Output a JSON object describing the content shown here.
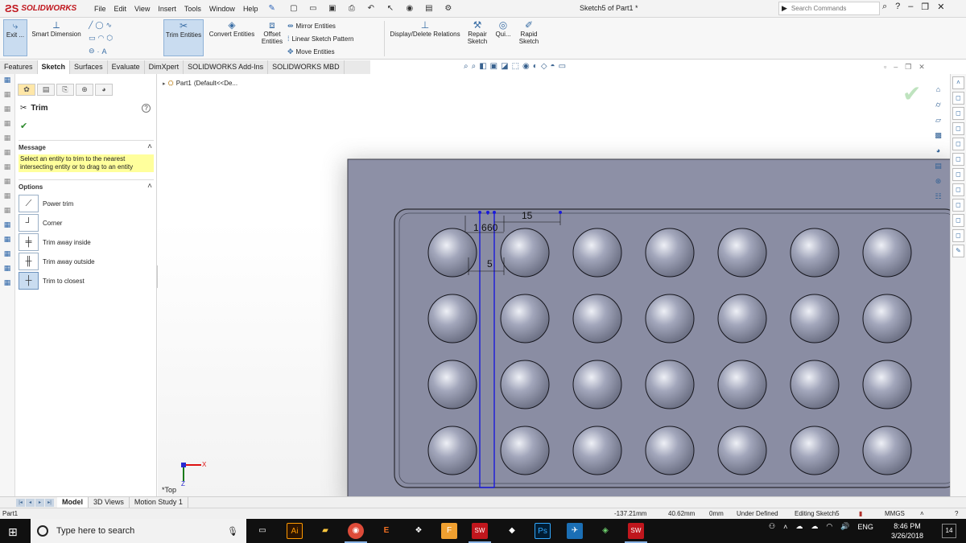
{
  "app": {
    "brand": "SOLIDWORKS",
    "menu": [
      "File",
      "Edit",
      "View",
      "Insert",
      "Tools",
      "Window",
      "Help"
    ],
    "doc_title": "Sketch5 of Part1 *",
    "search_placeholder": "Search Commands"
  },
  "ribbon": {
    "exit": "Exit ...",
    "smart_dimension": "Smart Dimension",
    "trim_entities": "Trim Entities",
    "convert_entities": "Convert Entities",
    "offset_entities_1": "Offset",
    "offset_entities_2": "Entities",
    "mirror": "Mirror Entities",
    "linear_pattern": "Linear Sketch Pattern",
    "move": "Move Entities",
    "display_delete": "Display/Delete Relations",
    "repair_1": "Repair",
    "repair_2": "Sketch",
    "quick": "Qui...",
    "rapid_1": "Rapid",
    "rapid_2": "Sketch"
  },
  "tabs": [
    "Features",
    "Sketch",
    "Surfaces",
    "Evaluate",
    "DimXpert",
    "SOLIDWORKS Add-Ins",
    "SOLIDWORKS MBD"
  ],
  "tabs_selected": "Sketch",
  "property_manager": {
    "title": "Trim",
    "message_header": "Message",
    "message": "Select an entity to trim to the nearest intersecting entity or to drag to an entity",
    "options_header": "Options",
    "options": [
      "Power trim",
      "Corner",
      "Trim away inside",
      "Trim away outside",
      "Trim to closest"
    ],
    "selected_option": "Trim to closest"
  },
  "tree": {
    "part": "Part1",
    "config": "(Default<<De..."
  },
  "view_name": "*Top",
  "dimensions": {
    "d1": "1",
    "d2": "6",
    "d3": "60",
    "d4": "15",
    "d5": "5"
  },
  "bottom_tabs": [
    "Model",
    "3D Views",
    "Motion Study 1"
  ],
  "bottom_tab_selected": "Model",
  "status": {
    "part": "Part1",
    "x": "-137.21mm",
    "y": "40.62mm",
    "z": "0mm",
    "state": "Under Defined",
    "editing": "Editing Sketch5",
    "units": "MMGS"
  },
  "taskbar": {
    "search_placeholder": "Type here to search",
    "lang": "ENG",
    "time": "8:46 PM",
    "date": "3/26/2018",
    "notifications": "14"
  },
  "colors": {
    "part_face": "#8d90a6",
    "sketch_line": "#1a1adb",
    "accent": "#c0161d"
  }
}
